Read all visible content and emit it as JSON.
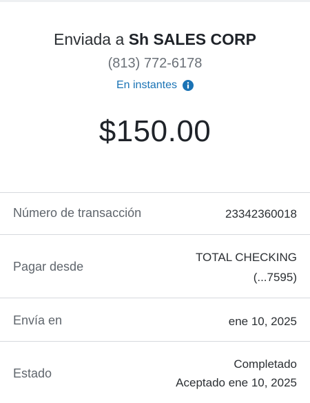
{
  "header": {
    "sent_prefix": "Enviada a",
    "recipient": "Sh SALES CORP",
    "phone": "(813) 772-6178",
    "speed_label": "En instantes",
    "amount": "$150.00"
  },
  "details": [
    {
      "label": "Número de transacción",
      "value": "23342360018"
    },
    {
      "label": "Pagar desde",
      "value": "TOTAL CHECKING",
      "value2": "(...7595)"
    },
    {
      "label": "Envía en",
      "value": "ene 10, 2025"
    },
    {
      "label": "Estado",
      "value": "Completado",
      "value2": "Aceptado ene 10, 2025"
    }
  ],
  "colors": {
    "accent": "#1a73b5",
    "divider": "#d6d9dd"
  }
}
